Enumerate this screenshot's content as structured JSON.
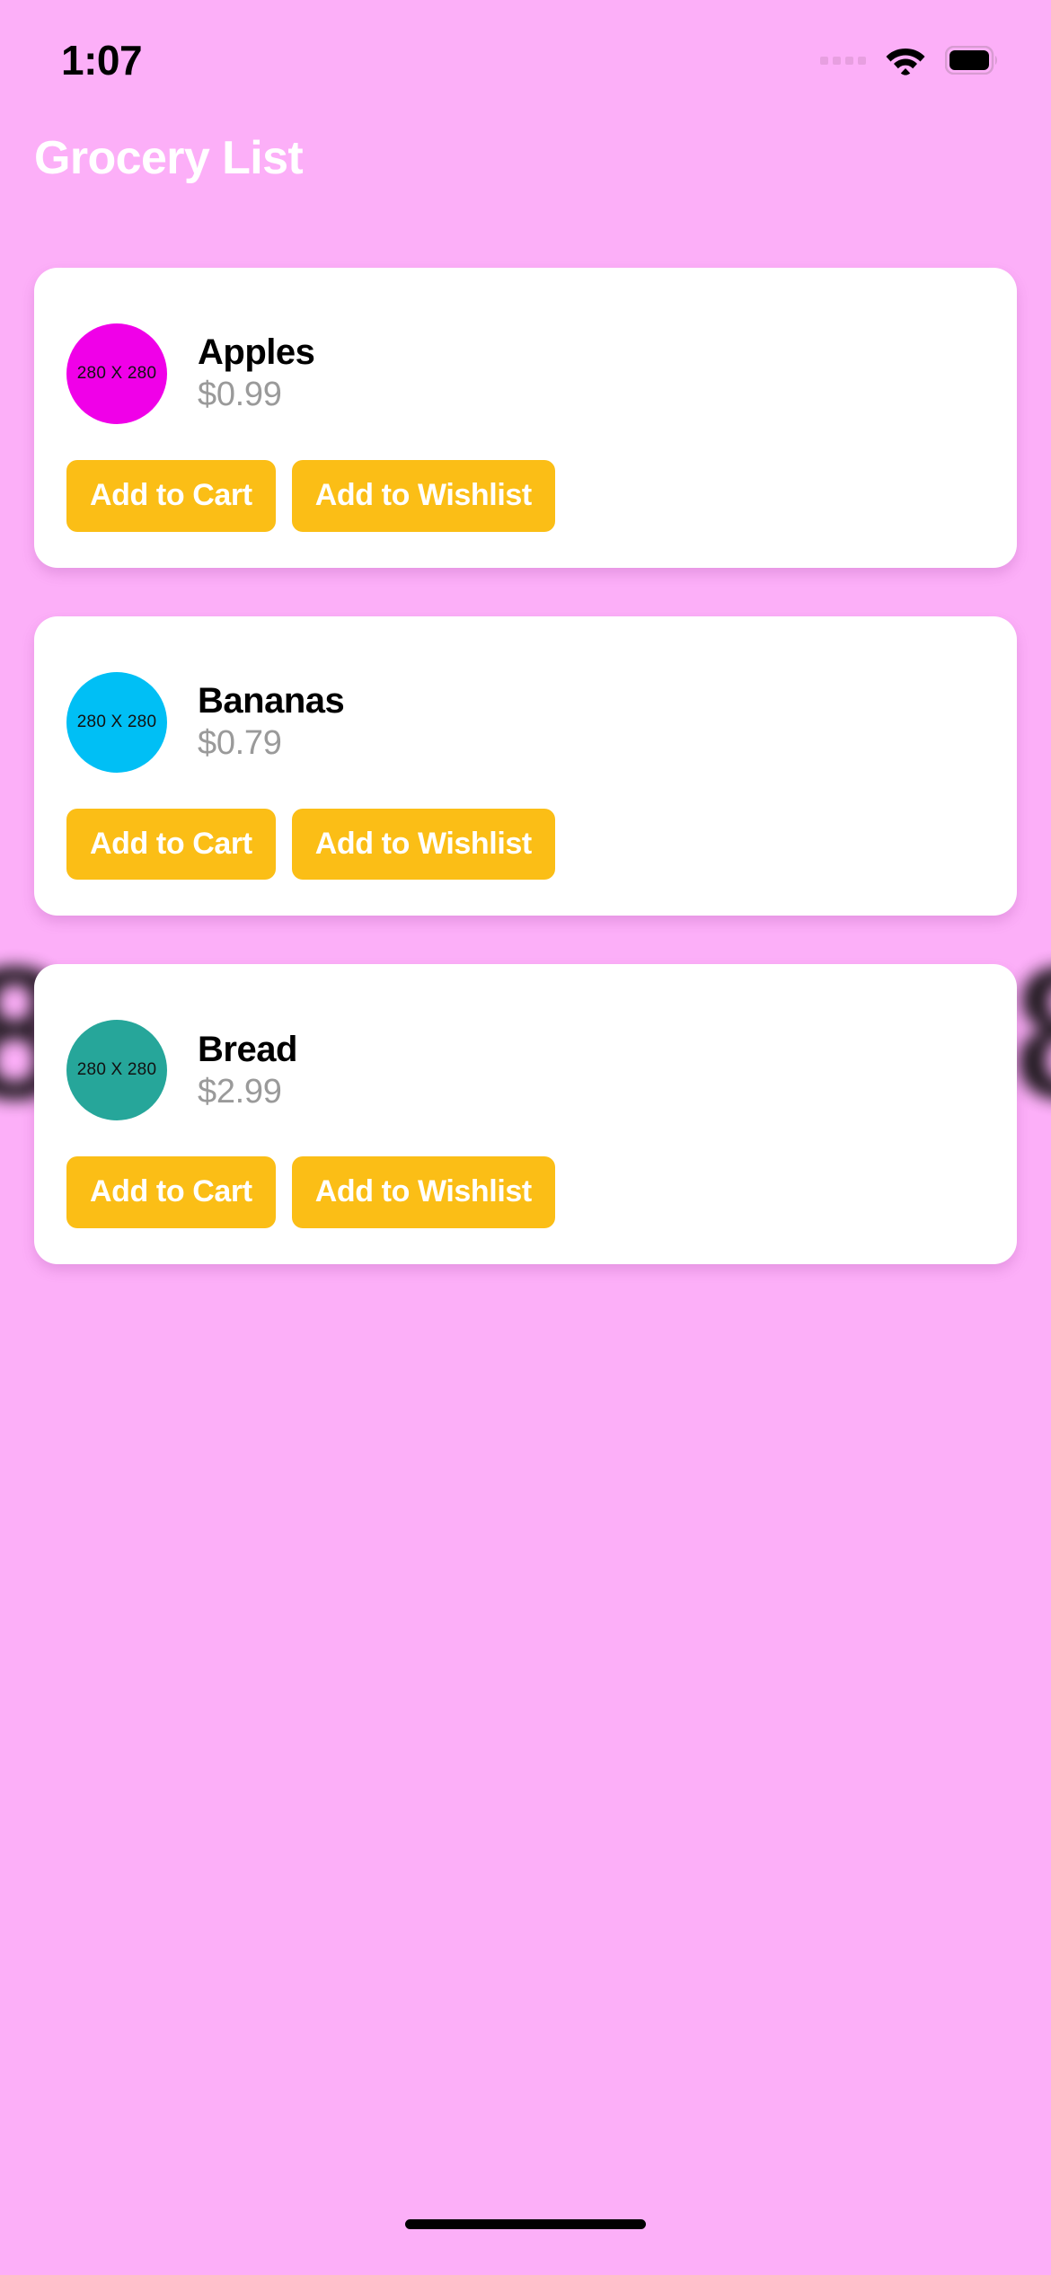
{
  "status_bar": {
    "time": "1:07",
    "signal_icon": "signal-dots-icon",
    "wifi_icon": "wifi-icon",
    "battery_icon": "battery-full-icon"
  },
  "header": {
    "title": "Grocery List",
    "title_color": "#FFFFFF"
  },
  "theme": {
    "background": "#FCAFF8",
    "card_background": "#FFFFFF",
    "button_color": "#FBBE16",
    "button_text_color": "#FFFFFF",
    "price_color": "#9A9A9A"
  },
  "products": [
    {
      "name": "Apples",
      "price": "$0.99",
      "thumb_label": "280 X 280",
      "thumb_color": "#F000E8",
      "add_to_cart_label": "Add to Cart",
      "add_to_wishlist_label": "Add to Wishlist"
    },
    {
      "name": "Bananas",
      "price": "$0.79",
      "thumb_label": "280 X 280",
      "thumb_color": "#00BFF5",
      "add_to_cart_label": "Add to Cart",
      "add_to_wishlist_label": "Add to Wishlist"
    },
    {
      "name": "Bread",
      "price": "$2.99",
      "thumb_label": "280 X 280",
      "thumb_color": "#26A69A",
      "add_to_cart_label": "Add to Cart",
      "add_to_wishlist_label": "Add to Wishlist"
    }
  ],
  "background_artifacts": {
    "left_glyph": "8",
    "right_glyph": "8"
  },
  "home_indicator": {
    "label": "home-indicator"
  }
}
